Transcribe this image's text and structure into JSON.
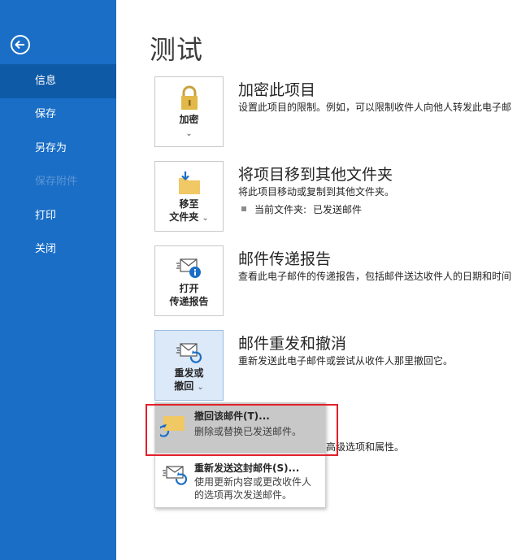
{
  "sidebar": {
    "items": [
      {
        "label": "信息",
        "selected": true,
        "disabled": false
      },
      {
        "label": "保存",
        "selected": false,
        "disabled": false
      },
      {
        "label": "另存为",
        "selected": false,
        "disabled": false
      },
      {
        "label": "保存附件",
        "selected": false,
        "disabled": true
      },
      {
        "label": "打印",
        "selected": false,
        "disabled": false
      },
      {
        "label": "关闭",
        "selected": false,
        "disabled": false
      }
    ],
    "back_icon": "arrow-left-circle-icon",
    "bg_color": "#1a6ec6",
    "selected_color": "#0f5aa6"
  },
  "main": {
    "title": "测试",
    "sections": [
      {
        "button_line1": "加密",
        "icon": "lock-icon",
        "title": "加密此项目",
        "desc": "设置此项目的限制。例如，可以限制收件人向他人转发此电子邮"
      },
      {
        "button_line1": "移至",
        "button_line2": "文件夹",
        "icon": "move-to-folder-icon",
        "title": "将项目移到其他文件夹",
        "desc": "将此项目移动或复制到其他文件夹。",
        "bullet_label": "当前文件夹:",
        "bullet_value": "已发送邮件"
      },
      {
        "button_line1": "打开",
        "button_line2": "传递报告",
        "icon": "delivery-report-icon",
        "title": "邮件传递报告",
        "desc": "查看此电子邮件的传递报告，包括邮件送达收件人的日期和时间"
      },
      {
        "button_line1": "重发或",
        "button_line2": "撤回",
        "icon": "resend-recall-icon",
        "title": "邮件重发和撤消",
        "desc": "重新发送此电子邮件或尝试从收件人那里撤回它。"
      }
    ],
    "partially_hidden_text": "高级选项和属性。"
  },
  "dropdown": {
    "items": [
      {
        "title": "撤回该邮件(T)...",
        "desc": "删除或替换已发送邮件。",
        "icon": "recall-message-icon"
      },
      {
        "title": "重新发送这封邮件(S)...",
        "desc": "使用更新内容或更改收件人的选项再次发送邮件。",
        "icon": "resend-message-icon"
      }
    ]
  },
  "colors": {
    "accent": "#1a6ec6",
    "highlight": "#e0202a"
  }
}
